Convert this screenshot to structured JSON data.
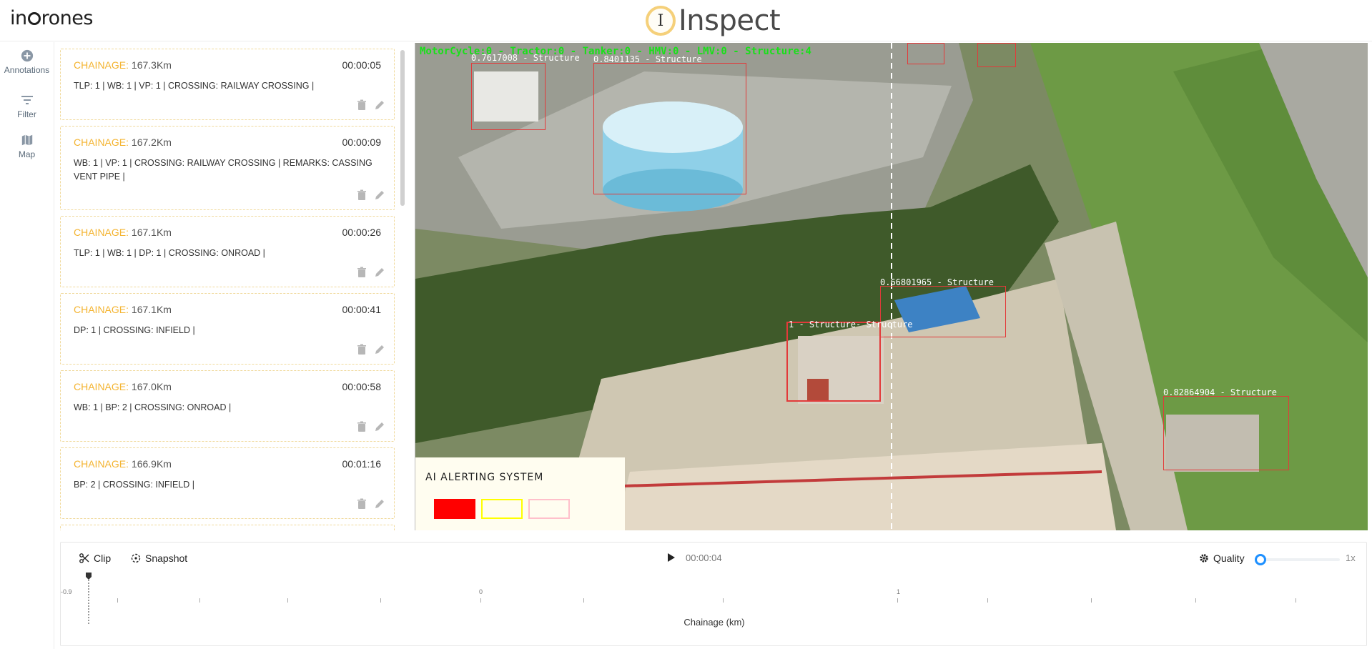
{
  "header": {
    "logo_pre": "in",
    "logo_post": "rones",
    "app_icon_letter": "I",
    "app_name": "Inspect"
  },
  "nav": {
    "items": [
      {
        "label": "Annotations",
        "icon": "plus-circle-icon"
      },
      {
        "label": "Filter",
        "icon": "filter-icon"
      },
      {
        "label": "Map",
        "icon": "map-icon"
      }
    ]
  },
  "annotations": [
    {
      "chainage_label": "CHAINAGE:",
      "chainage": "167.3Km",
      "time": "00:00:05",
      "desc": "TLP: 1 | WB: 1 | VP: 1 | CROSSING: RAILWAY CROSSING |"
    },
    {
      "chainage_label": "CHAINAGE:",
      "chainage": "167.2Km",
      "time": "00:00:09",
      "desc": "WB: 1 | VP: 1 | CROSSING: RAILWAY CROSSING | REMARKS: CASSING VENT PIPE |"
    },
    {
      "chainage_label": "CHAINAGE:",
      "chainage": "167.1Km",
      "time": "00:00:26",
      "desc": "TLP: 1 | WB: 1 | DP: 1 | CROSSING: ONROAD |"
    },
    {
      "chainage_label": "CHAINAGE:",
      "chainage": "167.1Km",
      "time": "00:00:41",
      "desc": "DP: 1 | CROSSING: INFIELD |"
    },
    {
      "chainage_label": "CHAINAGE:",
      "chainage": "167.0Km",
      "time": "00:00:58",
      "desc": "WB: 1 | BP: 2 | CROSSING: ONROAD |"
    },
    {
      "chainage_label": "CHAINAGE:",
      "chainage": "166.9Km",
      "time": "00:01:16",
      "desc": "BP: 2 | CROSSING: INFIELD |"
    }
  ],
  "video": {
    "overlay_text": "MotorCycle:0 - Tractor:0 - Tanker:0 - HMV:0 - LMV:0 - Structure:4",
    "detections": [
      {
        "label": "0.7617008 - Structure"
      },
      {
        "label": "0.8401135 - Structure"
      },
      {
        "label": "0.66801965 - Structure"
      },
      {
        "label": "1 - Structure"
      },
      {
        "label": "- Structure"
      },
      {
        "label": "0.82864904 - Structure"
      }
    ],
    "alert": {
      "title": "AI ALERTING SYSTEM",
      "colors": [
        "#ff0000",
        "#ffff00",
        "#ffc0cb"
      ]
    }
  },
  "timeline": {
    "clip_label": "Clip",
    "snapshot_label": "Snapshot",
    "current_time": "00:00:04",
    "quality_label": "Quality",
    "speed": "1x",
    "axis_label": "Chainage (km)",
    "tick_labels": [
      "-0.9",
      "0",
      "1"
    ]
  }
}
